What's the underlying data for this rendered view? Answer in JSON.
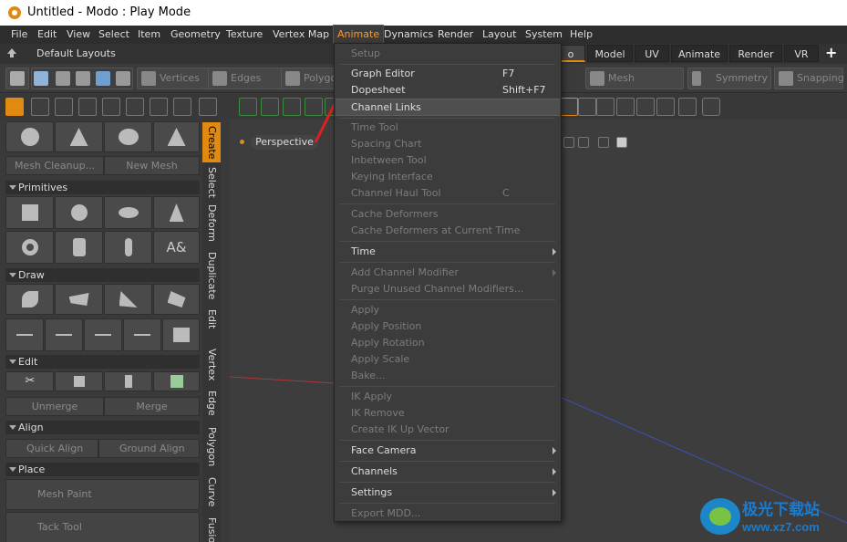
{
  "window": {
    "title": "Untitled - Modo : Play Mode"
  },
  "menubar": {
    "items": [
      "File",
      "Edit",
      "View",
      "Select",
      "Item",
      "Geometry",
      "Texture",
      "Vertex Map",
      "Animate",
      "Dynamics",
      "Render",
      "Layout",
      "System",
      "Help"
    ],
    "active": "Animate"
  },
  "layoutbar": {
    "label": "Default Layouts"
  },
  "workspace_tabs": {
    "items": [
      "o",
      "Model",
      "UV",
      "Animate",
      "Render",
      "VR"
    ],
    "plus": "+"
  },
  "toolbar": {
    "vertices": "Vertices",
    "edges": "Edges",
    "polygons": "Polygo",
    "mesh_constraint": "Mesh Constraint",
    "symmetry": "Symmetry",
    "snapping": "Snapping"
  },
  "side_tabs": [
    "Create",
    "Select",
    "Deform",
    "Duplicate",
    "Edit",
    "Vertex",
    "Edge",
    "Polygon",
    "Curve",
    "Fusio"
  ],
  "side_panel": {
    "mesh_cleanup": "Mesh Cleanup...",
    "new_mesh": "New Mesh",
    "primitives_header": "Primitives",
    "draw_header": "Draw",
    "edit_header": "Edit",
    "unmerge": "Unmerge",
    "merge": "Merge",
    "align_header": "Align",
    "quick_align": "Quick Align",
    "ground_align": "Ground Align",
    "place_header": "Place",
    "mesh_paint": "Mesh Paint",
    "tack_tool": "Tack Tool",
    "text_tool_glyph": "A&"
  },
  "viewport": {
    "view_label": "Perspective"
  },
  "animate_menu": {
    "setup": "Setup",
    "graph_editor": "Graph Editor",
    "graph_editor_sc": "F7",
    "dopesheet": "Dopesheet",
    "dopesheet_sc": "Shift+F7",
    "channel_links": "Channel Links",
    "time_tool": "Time Tool",
    "spacing_chart": "Spacing Chart",
    "inbetween_tool": "Inbetween Tool",
    "keying_interface": "Keying Interface",
    "channel_haul_tool": "Channel Haul Tool",
    "channel_haul_sc": "C",
    "cache_deformers": "Cache Deformers",
    "cache_deformers_time": "Cache Deformers at Current Time",
    "time": "Time",
    "add_channel_modifier": "Add Channel Modifier",
    "purge_modifiers": "Purge Unused Channel Modifiers...",
    "apply": "Apply",
    "apply_position": "Apply Position",
    "apply_rotation": "Apply Rotation",
    "apply_scale": "Apply Scale",
    "bake": "Bake...",
    "ik_apply": "IK Apply",
    "ik_remove": "IK Remove",
    "create_ik_up": "Create IK Up Vector",
    "face_camera": "Face Camera",
    "channels": "Channels",
    "settings": "Settings",
    "export_mdd": "Export MDD..."
  },
  "watermark": {
    "line1": "极光下载站",
    "line2": "www.xz7.com"
  },
  "colors": {
    "accent": "#e08a12",
    "annotation_arrow": "#e02020",
    "grid_red": "#b03030",
    "grid_blue": "#3050c0"
  }
}
